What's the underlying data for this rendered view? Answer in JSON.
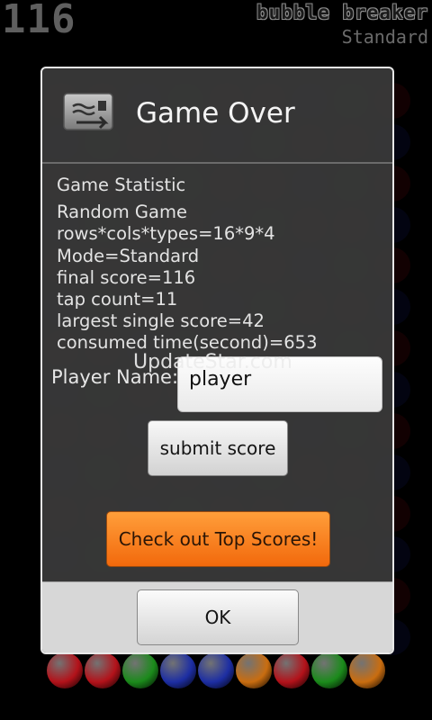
{
  "hud": {
    "score": "116",
    "brand": "bubble breaker",
    "mode": "Standard"
  },
  "colors": {
    "red": "#b3121a",
    "green": "#1b8a1b",
    "blue": "#1d2ea3",
    "orange": "#c96d10",
    "accent": "#f57a1c"
  },
  "bottom_balls": [
    "red",
    "red",
    "green",
    "blue",
    "blue",
    "orange",
    "red",
    "green",
    "orange"
  ],
  "dialog": {
    "icon": "email-card-icon",
    "title": "Game Over",
    "stats": {
      "heading": "Game Statistic",
      "game_type": "Random Game",
      "grid": "rows*cols*types=16*9*4",
      "mode": "Mode=Standard",
      "final_score": "final score=116",
      "tap_count": "tap count=11",
      "largest_score": "largest single score=42",
      "consumed_time": "consumed time(second)=653"
    },
    "watermark": "UpdateStar.com",
    "player_label": "Player Name:",
    "player_value": "player",
    "submit_label": "submit score",
    "top_scores_label": "Check out Top Scores!",
    "ok_label": "OK"
  }
}
